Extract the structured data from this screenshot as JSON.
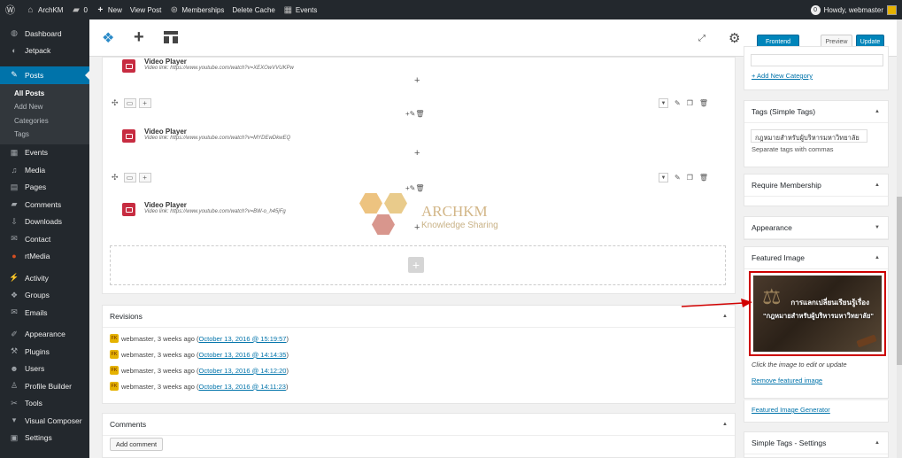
{
  "adminbar": {
    "wp_logo": "wordpress-icon",
    "site_name": "ArchKM",
    "comments_count": "0",
    "new": "New",
    "view_post": "View Post",
    "memberships": "Memberships",
    "delete_cache": "Delete Cache",
    "events": "Events",
    "howdy": "Howdy, webmaster",
    "badge_count": "0"
  },
  "sidebar": {
    "items": [
      {
        "label": "Dashboard",
        "icon": "dashboard-icon"
      },
      {
        "label": "Jetpack",
        "icon": "jetpack-icon"
      },
      {
        "label": "Posts",
        "icon": "pin-icon"
      }
    ],
    "posts_sub": [
      "All Posts",
      "Add New",
      "Categories",
      "Tags"
    ],
    "items2": [
      {
        "label": "Events",
        "icon": "calendar-icon"
      },
      {
        "label": "Media",
        "icon": "media-icon"
      },
      {
        "label": "Pages",
        "icon": "pages-icon"
      },
      {
        "label": "Comments",
        "icon": "comments-icon"
      },
      {
        "label": "Downloads",
        "icon": "download-icon"
      },
      {
        "label": "Contact",
        "icon": "mail-icon"
      },
      {
        "label": "rtMedia",
        "icon": "rtmedia-icon"
      },
      {
        "label": "Activity",
        "icon": "activity-icon"
      },
      {
        "label": "Groups",
        "icon": "groups-icon"
      },
      {
        "label": "Emails",
        "icon": "email-icon"
      },
      {
        "label": "Appearance",
        "icon": "brush-icon"
      },
      {
        "label": "Plugins",
        "icon": "plugin-icon"
      },
      {
        "label": "Users",
        "icon": "users-icon"
      },
      {
        "label": "Profile Builder",
        "icon": "profile-icon"
      },
      {
        "label": "Tools",
        "icon": "tools-icon"
      },
      {
        "label": "Visual Composer",
        "icon": "visual-composer-icon"
      },
      {
        "label": "Settings",
        "icon": "settings-icon"
      }
    ]
  },
  "toolbar": {
    "frontend": "Frontend",
    "preview": "Preview",
    "update": "Update"
  },
  "editor": {
    "video1": {
      "title": "Video Player",
      "link": "Video link: https://www.youtube.com/watch?v=XEXOwVVUKPw"
    },
    "video2": {
      "title": "Video Player",
      "link": "Video link: https://www.youtube.com/watch?v=MYDEwDkwEQ"
    },
    "video3": {
      "title": "Video Player",
      "link": "Video link: https://www.youtube.com/watch?v=BW-o_h45jFg"
    }
  },
  "watermark": {
    "title": "ARCHKM",
    "subtitle": "Knowledge Sharing"
  },
  "revisions": {
    "title": "Revisions",
    "items": [
      {
        "author": "webmaster",
        "ago": ", 3 weeks ago (",
        "date": "October 13, 2016 @ 15:19:57",
        "close": ")"
      },
      {
        "author": "webmaster",
        "ago": ", 3 weeks ago (",
        "date": "October 13, 2016 @ 14:14:35",
        "close": ")"
      },
      {
        "author": "webmaster",
        "ago": ", 3 weeks ago (",
        "date": "October 13, 2016 @ 14:12:20",
        "close": ")"
      },
      {
        "author": "webmaster",
        "ago": ", 3 weeks ago (",
        "date": "October 13, 2016 @ 14:11:23",
        "close": ")"
      }
    ]
  },
  "comments": {
    "title": "Comments",
    "add_button": "Add comment"
  },
  "sidebar_right": {
    "add_category": "+ Add New Category",
    "tags_title": "Tags (Simple Tags)",
    "tags_value": "กฎหมายสำหรับผู้บริหารมหาวิทยาลัย",
    "tags_help": "Separate tags with commas",
    "membership_title": "Require Membership",
    "appearance_title": "Appearance",
    "featured_title": "Featured Image",
    "featured_img_line1": "การแลกเปลี่ยนเรียนรู้เรื่อง",
    "featured_img_line2": "\"กฎหมายสำหรับผู้บริหารมหาวิทยาลัย\"",
    "click_edit": "Click the image to edit or update",
    "remove_featured": "Remove featured image",
    "featured_generator": "Featured Image Generator",
    "simple_tags_settings": "Simple Tags - Settings"
  },
  "colors": {
    "accent": "#0073aa",
    "admin_dark": "#23282d",
    "highlight": "#cc0000",
    "video_icon": "#c72c41"
  }
}
